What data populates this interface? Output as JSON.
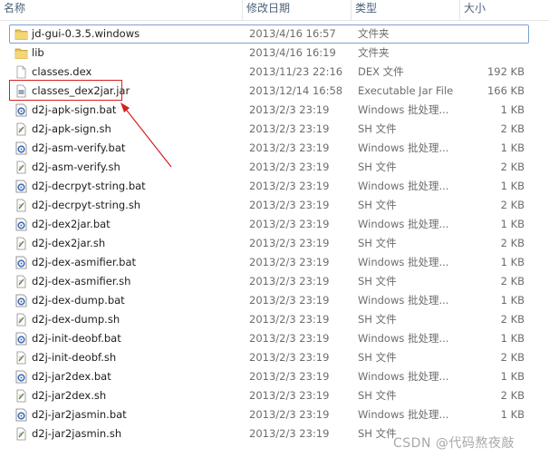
{
  "columns": {
    "name": "名称",
    "date": "修改日期",
    "type": "类型",
    "size": "大小"
  },
  "files": [
    {
      "name": "jd-gui-0.3.5.windows",
      "date": "2013/4/16 16:57",
      "type": "文件夹",
      "size": "",
      "icon": "folder-icon"
    },
    {
      "name": "lib",
      "date": "2013/4/16 16:19",
      "type": "文件夹",
      "size": "",
      "icon": "folder-icon"
    },
    {
      "name": "classes.dex",
      "date": "2013/11/23 22:16",
      "type": "DEX 文件",
      "size": "192 KB",
      "icon": "blank-file-icon"
    },
    {
      "name": "classes_dex2jar.jar",
      "date": "2013/12/14 16:58",
      "type": "Executable Jar File",
      "size": "166 KB",
      "icon": "jar-file-icon"
    },
    {
      "name": "d2j-apk-sign.bat",
      "date": "2013/2/3 23:19",
      "type": "Windows 批处理...",
      "size": "1 KB",
      "icon": "batch-file-icon"
    },
    {
      "name": "d2j-apk-sign.sh",
      "date": "2013/2/3 23:19",
      "type": "SH 文件",
      "size": "2 KB",
      "icon": "script-file-icon"
    },
    {
      "name": "d2j-asm-verify.bat",
      "date": "2013/2/3 23:19",
      "type": "Windows 批处理...",
      "size": "1 KB",
      "icon": "batch-file-icon"
    },
    {
      "name": "d2j-asm-verify.sh",
      "date": "2013/2/3 23:19",
      "type": "SH 文件",
      "size": "2 KB",
      "icon": "script-file-icon"
    },
    {
      "name": "d2j-decrpyt-string.bat",
      "date": "2013/2/3 23:19",
      "type": "Windows 批处理...",
      "size": "1 KB",
      "icon": "batch-file-icon"
    },
    {
      "name": "d2j-decrpyt-string.sh",
      "date": "2013/2/3 23:19",
      "type": "SH 文件",
      "size": "2 KB",
      "icon": "script-file-icon"
    },
    {
      "name": "d2j-dex2jar.bat",
      "date": "2013/2/3 23:19",
      "type": "Windows 批处理...",
      "size": "1 KB",
      "icon": "batch-file-icon"
    },
    {
      "name": "d2j-dex2jar.sh",
      "date": "2013/2/3 23:19",
      "type": "SH 文件",
      "size": "2 KB",
      "icon": "script-file-icon"
    },
    {
      "name": "d2j-dex-asmifier.bat",
      "date": "2013/2/3 23:19",
      "type": "Windows 批处理...",
      "size": "1 KB",
      "icon": "batch-file-icon"
    },
    {
      "name": "d2j-dex-asmifier.sh",
      "date": "2013/2/3 23:19",
      "type": "SH 文件",
      "size": "2 KB",
      "icon": "script-file-icon"
    },
    {
      "name": "d2j-dex-dump.bat",
      "date": "2013/2/3 23:19",
      "type": "Windows 批处理...",
      "size": "1 KB",
      "icon": "batch-file-icon"
    },
    {
      "name": "d2j-dex-dump.sh",
      "date": "2013/2/3 23:19",
      "type": "SH 文件",
      "size": "2 KB",
      "icon": "script-file-icon"
    },
    {
      "name": "d2j-init-deobf.bat",
      "date": "2013/2/3 23:19",
      "type": "Windows 批处理...",
      "size": "1 KB",
      "icon": "batch-file-icon"
    },
    {
      "name": "d2j-init-deobf.sh",
      "date": "2013/2/3 23:19",
      "type": "SH 文件",
      "size": "2 KB",
      "icon": "script-file-icon"
    },
    {
      "name": "d2j-jar2dex.bat",
      "date": "2013/2/3 23:19",
      "type": "Windows 批处理...",
      "size": "1 KB",
      "icon": "batch-file-icon"
    },
    {
      "name": "d2j-jar2dex.sh",
      "date": "2013/2/3 23:19",
      "type": "SH 文件",
      "size": "2 KB",
      "icon": "script-file-icon"
    },
    {
      "name": "d2j-jar2jasmin.bat",
      "date": "2013/2/3 23:19",
      "type": "Windows 批处理...",
      "size": "1 KB",
      "icon": "batch-file-icon"
    },
    {
      "name": "d2j-jar2jasmin.sh",
      "date": "2013/2/3 23:19",
      "type": "SH 文件",
      "size": "",
      "icon": "script-file-icon"
    }
  ],
  "watermark": "CSDN @代码熬夜敲",
  "colors": {
    "folder": "#e8c04a",
    "selection_border": "#7da2ce",
    "highlight": "#d42020",
    "header_text": "#4c607a"
  }
}
